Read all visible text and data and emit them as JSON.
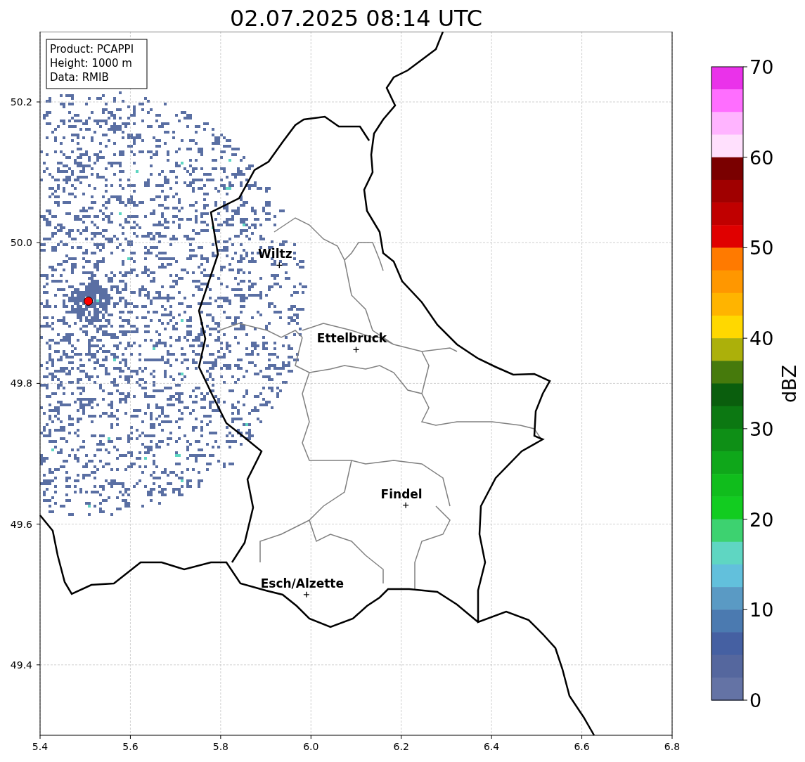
{
  "title": "02.07.2025 08:14 UTC",
  "info_box": [
    "Product: PCAPPI",
    "Height: 1000 m",
    "Data: RMIB"
  ],
  "axes": {
    "xticks": [
      "5.4",
      "5.6",
      "5.8",
      "6.0",
      "6.2",
      "6.4",
      "6.6",
      "6.8"
    ],
    "yticks": [
      "50.2",
      "50.0",
      "49.8",
      "49.6",
      "49.4"
    ]
  },
  "cities": [
    {
      "name": "Wiltz"
    },
    {
      "name": "Ettelbruck"
    },
    {
      "name": "Findel"
    },
    {
      "name": "Esch/Alzette"
    }
  ],
  "colorbar": {
    "label": "dBZ",
    "ticks": [
      "70",
      "60",
      "50",
      "40",
      "30",
      "20",
      "10",
      "0"
    ],
    "bins": [
      {
        "color": "#ea32ea"
      },
      {
        "color": "#ff6eff"
      },
      {
        "color": "#ffb4ff"
      },
      {
        "color": "#ffe0fd"
      },
      {
        "color": "#7a0000"
      },
      {
        "color": "#a00000"
      },
      {
        "color": "#c00000"
      },
      {
        "color": "#e00000"
      },
      {
        "color": "#ff7a00"
      },
      {
        "color": "#ff9700"
      },
      {
        "color": "#ffb400"
      },
      {
        "color": "#ffd800"
      },
      {
        "color": "#acb00a"
      },
      {
        "color": "#467a0c"
      },
      {
        "color": "#0a5e0d"
      },
      {
        "color": "#0c7812"
      },
      {
        "color": "#0e8f16"
      },
      {
        "color": "#0fa71a"
      },
      {
        "color": "#10bd1c"
      },
      {
        "color": "#12cc20"
      },
      {
        "color": "#3dd270"
      },
      {
        "color": "#5fd6c2"
      },
      {
        "color": "#62c0dc"
      },
      {
        "color": "#5a9ac4"
      },
      {
        "color": "#4b7ab0"
      },
      {
        "color": "#4560a2"
      },
      {
        "color": "#55679e"
      },
      {
        "color": "#6473a5"
      }
    ]
  }
}
